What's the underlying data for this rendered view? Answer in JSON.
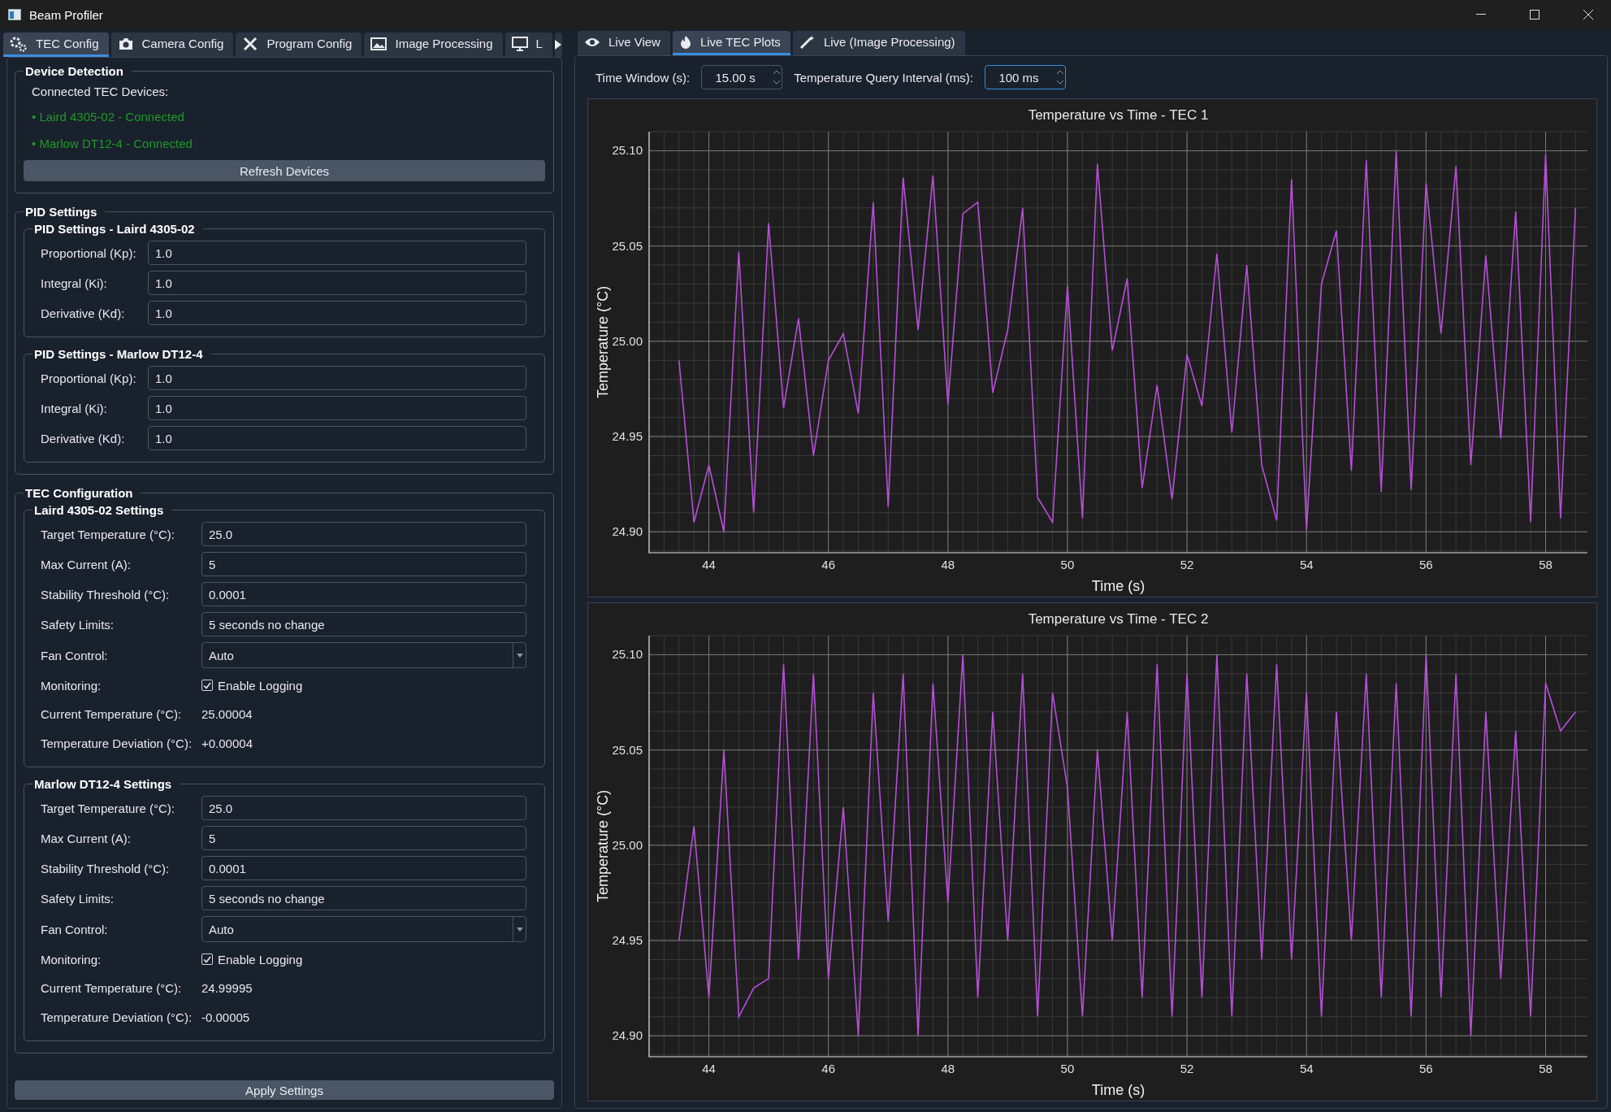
{
  "window": {
    "title": "Beam Profiler"
  },
  "left_tabs": [
    {
      "label": "TEC Config",
      "selected": true
    },
    {
      "label": "Camera Config",
      "selected": false
    },
    {
      "label": "Program Config",
      "selected": false
    },
    {
      "label": "Image Processing",
      "selected": false
    },
    {
      "label": "L",
      "selected": false
    }
  ],
  "right_tabs": [
    {
      "label": "Live View",
      "selected": false
    },
    {
      "label": "Live TEC Plots",
      "selected": true
    },
    {
      "label": "Live (Image Processing)",
      "selected": false
    }
  ],
  "device_detection": {
    "title": "Device Detection",
    "label": "Connected TEC Devices:",
    "devices": [
      "• Laird 4305-02 - Connected",
      "• Marlow DT12-4 - Connected"
    ],
    "button": "Refresh Devices"
  },
  "pid_settings": {
    "title": "PID Settings",
    "groups": [
      {
        "title": "PID Settings - Laird 4305-02",
        "fields": [
          {
            "label": "Proportional (Kp):",
            "value": "1.0"
          },
          {
            "label": "Integral (Ki):",
            "value": "1.0"
          },
          {
            "label": "Derivative (Kd):",
            "value": "1.0"
          }
        ]
      },
      {
        "title": "PID Settings - Marlow DT12-4",
        "fields": [
          {
            "label": "Proportional (Kp):",
            "value": "1.0"
          },
          {
            "label": "Integral (Ki):",
            "value": "1.0"
          },
          {
            "label": "Derivative (Kd):",
            "value": "1.0"
          }
        ]
      }
    ]
  },
  "tec_configuration": {
    "title": "TEC Configuration",
    "groups": [
      {
        "title": "Laird 4305-02 Settings",
        "rows": [
          {
            "kind": "input",
            "label": "Target Temperature (°C):",
            "value": "25.0"
          },
          {
            "kind": "input",
            "label": "Max Current (A):",
            "value": "5"
          },
          {
            "kind": "input",
            "label": "Stability Threshold (°C):",
            "value": "0.0001"
          },
          {
            "kind": "input",
            "label": "Safety Limits:",
            "value": "5 seconds no change"
          },
          {
            "kind": "select",
            "label": "Fan Control:",
            "value": "Auto"
          },
          {
            "kind": "checkbox",
            "label": "Monitoring:",
            "text": "Enable Logging",
            "checked": true
          },
          {
            "kind": "readout",
            "label": "Current Temperature (°C):",
            "value": "25.00004"
          },
          {
            "kind": "readout",
            "label": "Temperature Deviation (°C):",
            "value": "+0.00004"
          }
        ]
      },
      {
        "title": "Marlow DT12-4 Settings",
        "rows": [
          {
            "kind": "input",
            "label": "Target Temperature (°C):",
            "value": "25.0"
          },
          {
            "kind": "input",
            "label": "Max Current (A):",
            "value": "5"
          },
          {
            "kind": "input",
            "label": "Stability Threshold (°C):",
            "value": "0.0001"
          },
          {
            "kind": "input",
            "label": "Safety Limits:",
            "value": "5 seconds no change"
          },
          {
            "kind": "select",
            "label": "Fan Control:",
            "value": "Auto"
          },
          {
            "kind": "checkbox",
            "label": "Monitoring:",
            "text": "Enable Logging",
            "checked": true
          },
          {
            "kind": "readout",
            "label": "Current Temperature (°C):",
            "value": "24.99995"
          },
          {
            "kind": "readout",
            "label": "Temperature Deviation (°C):",
            "value": "-0.00005"
          }
        ]
      }
    ]
  },
  "apply_button": "Apply Settings",
  "plot_controls": [
    {
      "label": "Time Window (s):",
      "value": "15.00 s",
      "focused": false
    },
    {
      "label": "Temperature Query Interval (ms):",
      "value": "100 ms",
      "focused": true
    }
  ],
  "charts": [
    {
      "chart_data": {
        "type": "line",
        "title": "Temperature vs Time - TEC 1",
        "xlabel": "Time (s)",
        "ylabel": "Temperature (°C)",
        "xlim": [
          43,
          58.7
        ],
        "ylim": [
          24.889,
          25.11
        ],
        "xticks": [
          44,
          46,
          48,
          50,
          52,
          54,
          56,
          58
        ],
        "yticks": [
          {
            "value": 24.9,
            "label": "24.90"
          },
          {
            "value": 24.95,
            "label": "24.95"
          },
          {
            "value": 25,
            "label": "25.00"
          },
          {
            "value": 25.05,
            "label": "25.05"
          },
          {
            "value": 25.1,
            "label": "25.10"
          }
        ],
        "x": [
          43.5,
          43.75,
          44,
          44.25,
          44.5,
          44.75,
          45,
          45.25,
          45.5,
          45.75,
          46,
          46.25,
          46.5,
          46.75,
          47,
          47.25,
          47.5,
          47.75,
          48,
          48.25,
          48.5,
          48.75,
          49,
          49.25,
          49.5,
          49.75,
          50,
          50.25,
          50.5,
          50.75,
          51,
          51.25,
          51.5,
          51.75,
          52,
          52.25,
          52.5,
          52.75,
          53,
          53.25,
          53.5,
          53.75,
          54,
          54.25,
          54.5,
          54.75,
          55,
          55.25,
          55.5,
          55.75,
          56,
          56.25,
          56.5,
          56.75,
          57,
          57.25,
          57.5,
          57.75,
          58,
          58.25,
          58.5
        ],
        "grid": true,
        "series": [
          {
            "color": "#b74fd8",
            "values": [
              24.99,
              24.905,
              24.935,
              24.9,
              25.047,
              24.91,
              25.062,
              24.965,
              25.012,
              24.94,
              24.99,
              25.004,
              24.962,
              25.073,
              24.913,
              25.086,
              25.006,
              25.087,
              24.967,
              25.067,
              25.073,
              24.973,
              25.006,
              25.07,
              24.918,
              24.905,
              25.029,
              24.907,
              25.093,
              24.995,
              25.033,
              24.923,
              24.977,
              24.917,
              24.993,
              24.966,
              25.046,
              24.952,
              25.04,
              24.935,
              24.906,
              25.085,
              24.901,
              25.03,
              25.058,
              24.932,
              25.095,
              24.921,
              25.1,
              24.922,
              25.083,
              25.004,
              25.092,
              24.935,
              25.045,
              24.949,
              25.068,
              24.905,
              25.098,
              24.907,
              25.07
            ]
          }
        ]
      }
    },
    {
      "chart_data": {
        "type": "line",
        "title": "Temperature vs Time - TEC 2",
        "xlabel": "Time (s)",
        "ylabel": "Temperature (°C)",
        "xlim": [
          43,
          58.7
        ],
        "ylim": [
          24.889,
          25.11
        ],
        "xticks": [
          44,
          46,
          48,
          50,
          52,
          54,
          56,
          58
        ],
        "yticks": [
          {
            "value": 24.9,
            "label": "24.90"
          },
          {
            "value": 24.95,
            "label": "24.95"
          },
          {
            "value": 25,
            "label": "25.00"
          },
          {
            "value": 25.05,
            "label": "25.05"
          },
          {
            "value": 25.1,
            "label": "25.10"
          }
        ],
        "x": [
          43.5,
          43.75,
          44,
          44.25,
          44.5,
          44.75,
          45,
          45.25,
          45.5,
          45.75,
          46,
          46.25,
          46.5,
          46.75,
          47,
          47.25,
          47.5,
          47.75,
          48,
          48.25,
          48.5,
          48.75,
          49,
          49.25,
          49.5,
          49.75,
          50,
          50.25,
          50.5,
          50.75,
          51,
          51.25,
          51.5,
          51.75,
          52,
          52.25,
          52.5,
          52.75,
          53,
          53.25,
          53.5,
          53.75,
          54,
          54.25,
          54.5,
          54.75,
          55,
          55.25,
          55.5,
          55.75,
          56,
          56.25,
          56.5,
          56.75,
          57,
          57.25,
          57.5,
          57.75,
          58,
          58.25,
          58.5
        ],
        "grid": true,
        "series": [
          {
            "color": "#b74fd8",
            "values": [
              24.95,
              25.01,
              24.92,
              25.05,
              24.91,
              24.925,
              24.93,
              25.095,
              24.94,
              25.09,
              24.93,
              25.02,
              24.9,
              25.08,
              24.96,
              25.09,
              24.9,
              25.085,
              24.97,
              25.1,
              24.92,
              25.07,
              24.95,
              25.09,
              24.91,
              25.08,
              25.03,
              24.91,
              25.05,
              24.95,
              25.07,
              24.92,
              25.095,
              24.91,
              25.09,
              24.92,
              25.1,
              24.91,
              25.09,
              24.94,
              25.095,
              24.94,
              25.08,
              24.91,
              25.07,
              24.95,
              25.09,
              24.92,
              25.085,
              24.91,
              25.1,
              24.92,
              25.09,
              24.9,
              25.07,
              24.93,
              25.06,
              24.91,
              25.085,
              25.06,
              25.07
            ]
          }
        ]
      }
    }
  ]
}
